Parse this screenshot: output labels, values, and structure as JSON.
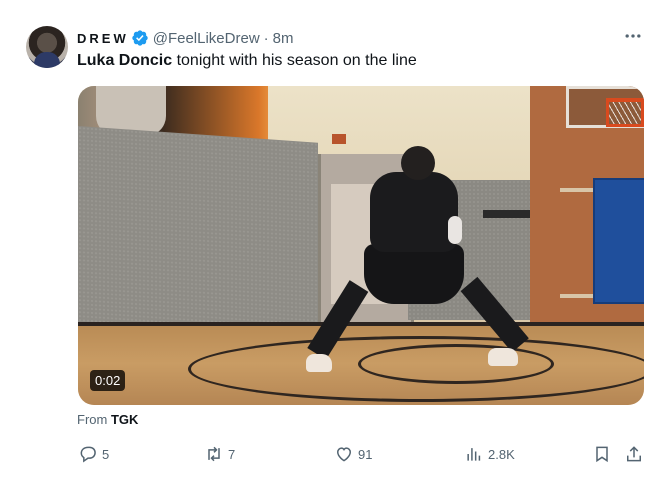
{
  "tweet": {
    "author_name": "DREW",
    "handle": "@FeelLikeDrew",
    "separator": "·",
    "time": "8m",
    "text_bold": "Luka Doncic",
    "text_rest": " tonight with his season on the line",
    "video_duration": "0:02",
    "from_label": "From",
    "from_source": "TGK",
    "replies": "5",
    "reposts": "7",
    "likes": "91",
    "views": "2.8K"
  },
  "colors": {
    "verified_blue": "#1d9bf0",
    "secondary_text": "#536471"
  },
  "icons": [
    "verified-icon",
    "more-icon",
    "reply-icon",
    "repost-icon",
    "like-icon",
    "views-icon",
    "bookmark-icon",
    "share-icon"
  ]
}
